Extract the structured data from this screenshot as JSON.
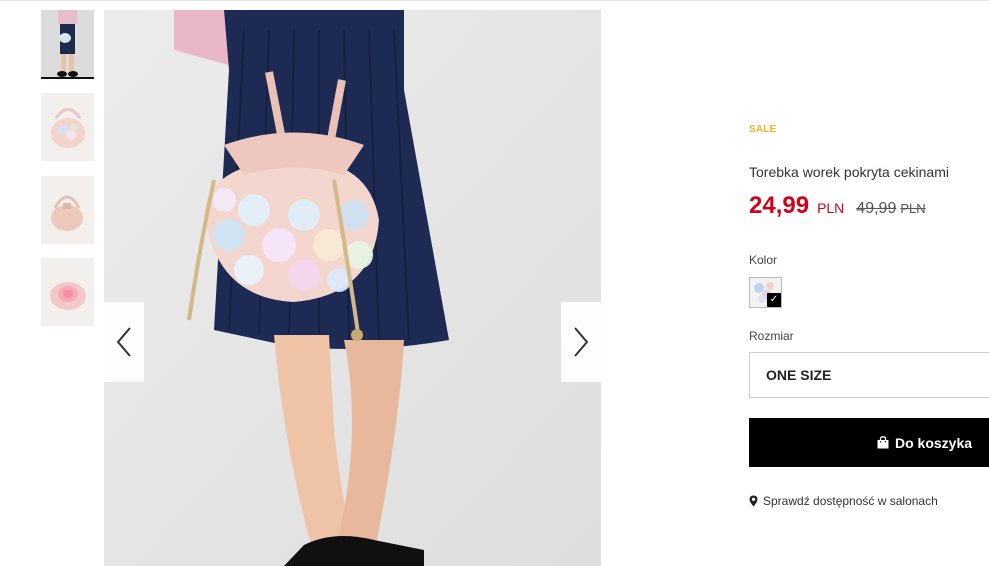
{
  "product": {
    "badge": "SALE",
    "title": "Torebka worek pokryta cekinami",
    "price": "24,99",
    "currency": "PLN",
    "old_price": "49,99",
    "old_currency": "PLN"
  },
  "color_section": {
    "label": "Kolor",
    "selected": true
  },
  "size_section": {
    "label": "Rozmiar",
    "value": "ONE SIZE"
  },
  "cart_button": {
    "label": "Do koszyka",
    "icon": "shopping-bag-icon"
  },
  "availability": {
    "label": "Sprawdź dostępność w salonach",
    "icon": "map-pin-icon"
  },
  "gallery": {
    "thumbnail_count": 4,
    "selected_index": 0,
    "prev_icon": "chevron-left-icon",
    "next_icon": "chevron-right-icon"
  },
  "colors": {
    "price": "#d0021b",
    "sale": "#e8b12a",
    "button": "#000000"
  }
}
